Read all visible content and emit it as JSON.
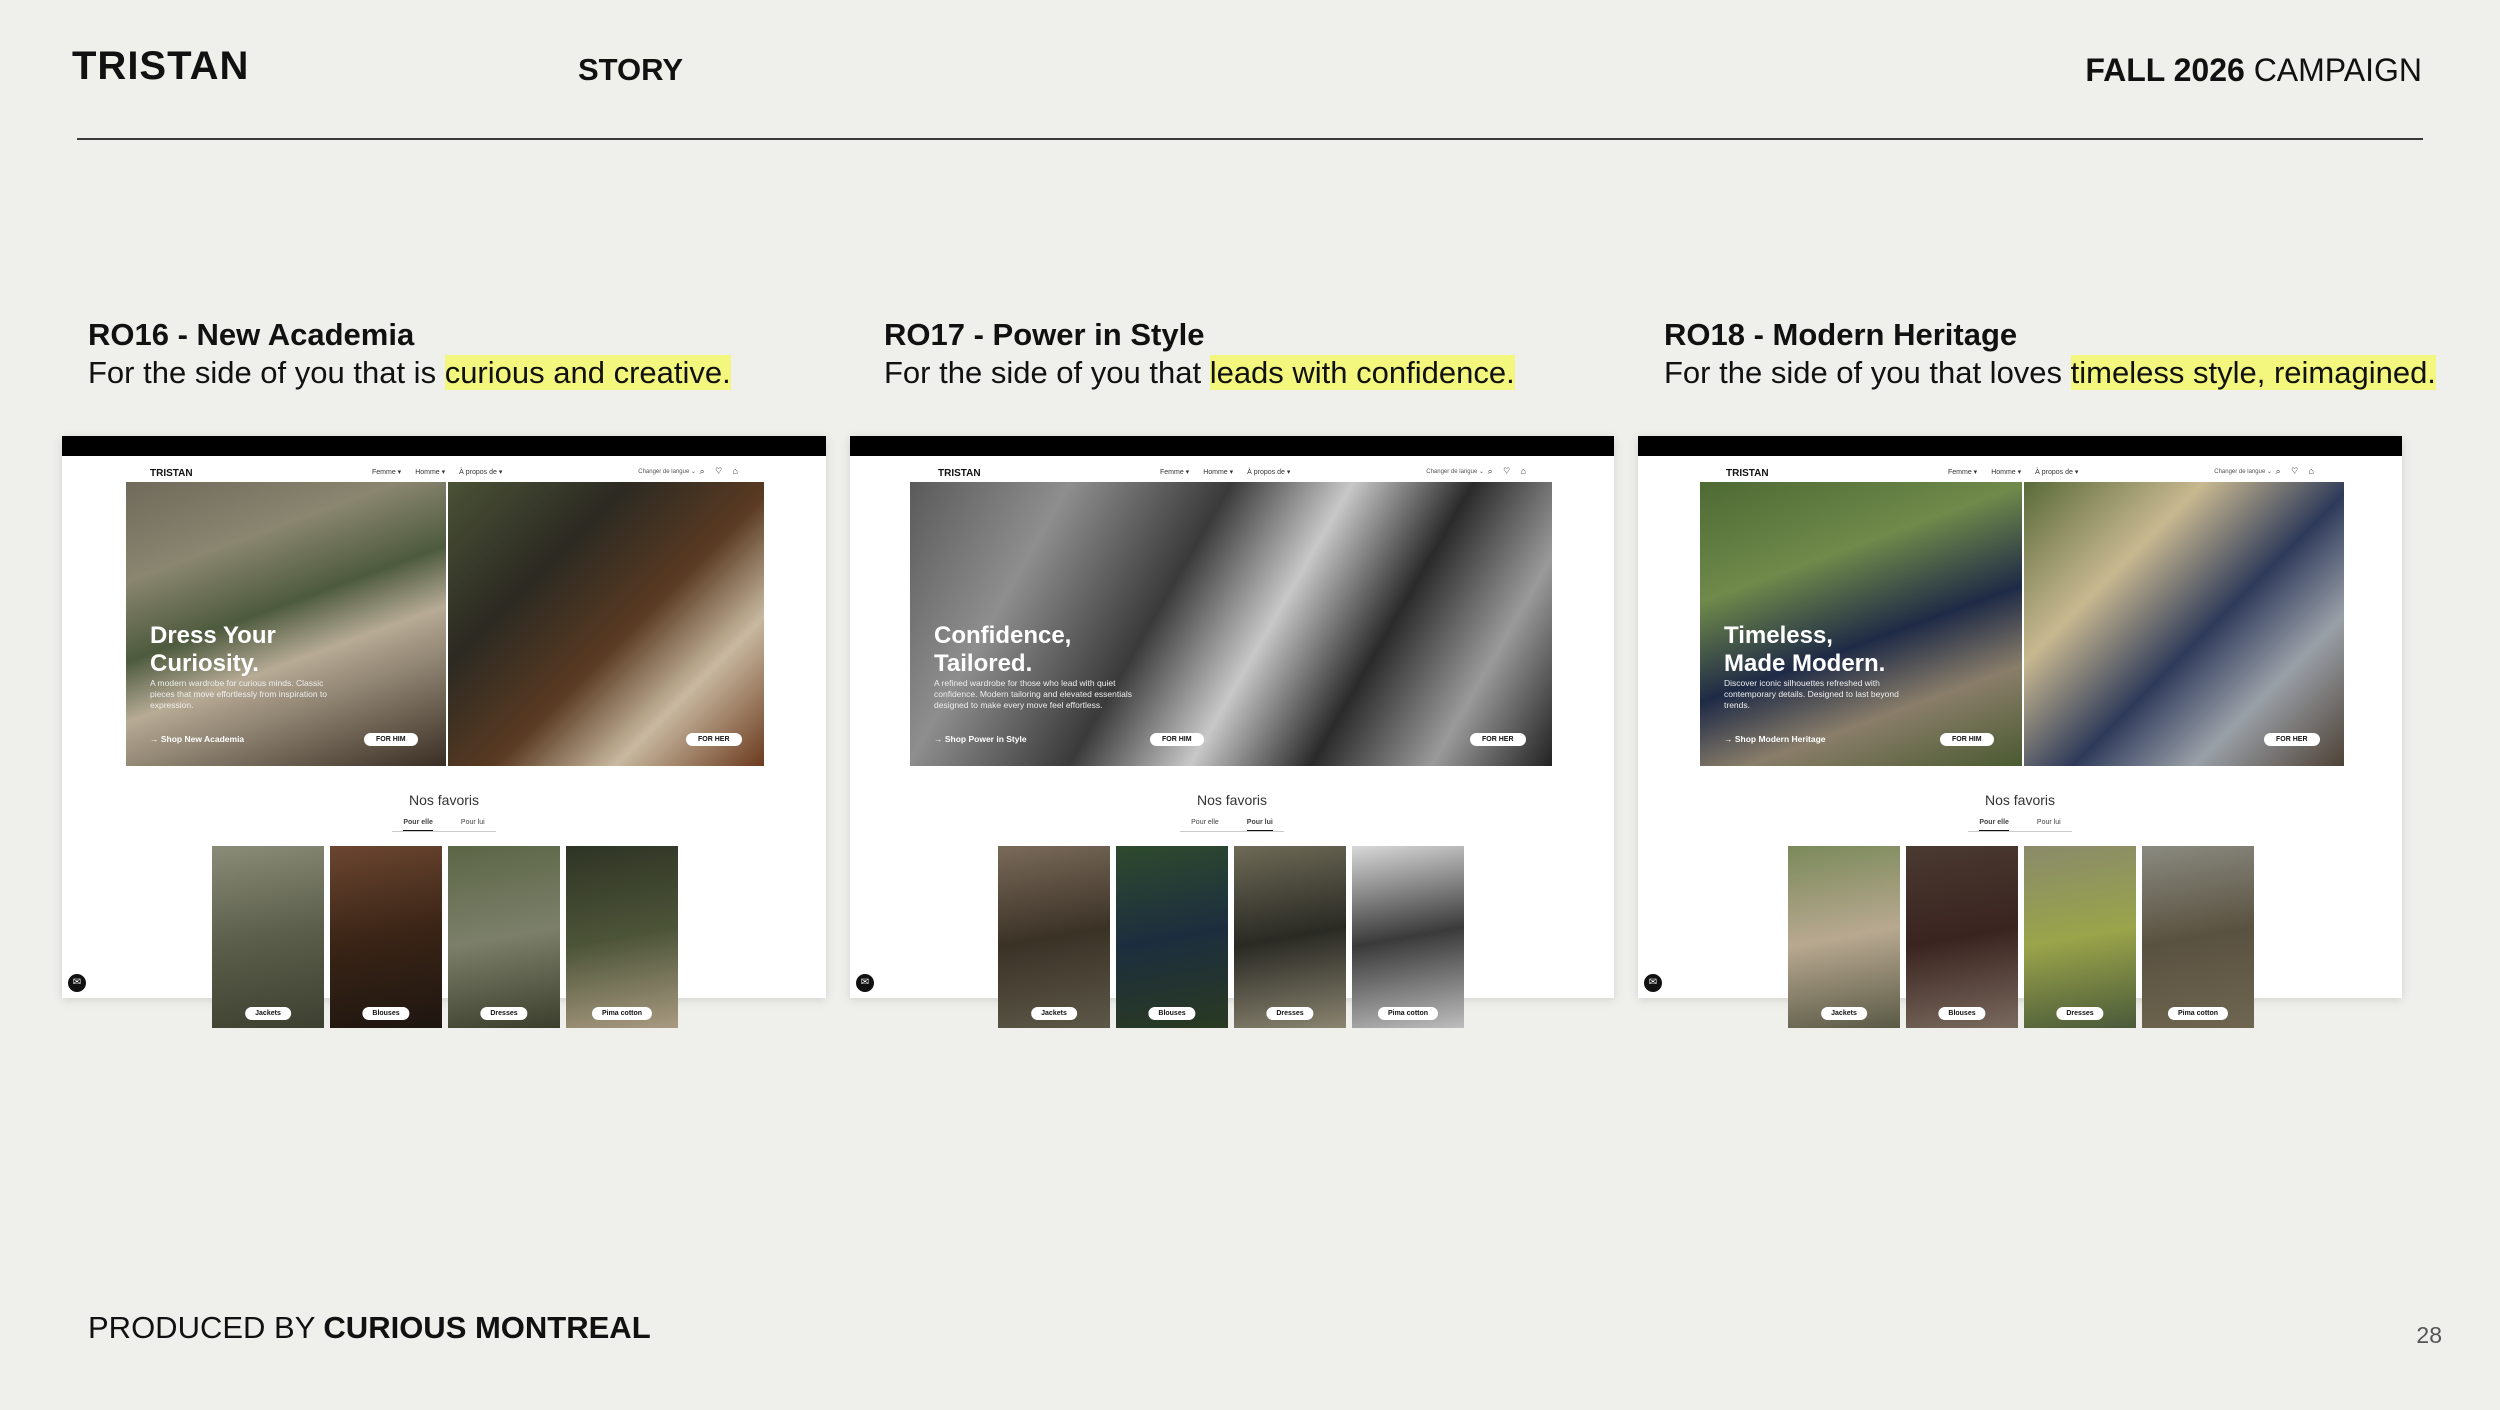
{
  "header": {
    "brand": "TRISTAN",
    "section": "STORY",
    "campaign_bold": "FALL 2026",
    "campaign_rest": " CAMPAIGN"
  },
  "footer": {
    "produced_prefix": "PRODUCED BY ",
    "produced_by": "CURIOUS MONTREAL",
    "page_number": "28"
  },
  "columns": [
    {
      "title": "RO16 - New Academia",
      "tagline_prefix": "For the side of you that is ",
      "tagline_highlight": "curious and creative.",
      "site": {
        "logo": "TRISTAN",
        "nav": [
          "Femme ▾",
          "Homme ▾",
          "À propos de ▾"
        ],
        "lang": "Changer de langue ⌄",
        "icons": "⌕ ♡ ⌂",
        "hero_title": "Dress Your\nCuriosity.",
        "hero_desc": "A modern wardrobe for curious minds. Classic pieces that move effortlessly from inspiration to expression.",
        "hero_cta": "→ Shop New Academia",
        "for_him": "FOR HIM",
        "for_her": "FOR HER",
        "favorites": "Nos favoris",
        "tab_her": "Pour elle",
        "tab_him": "Pour lui",
        "active_tab": "her",
        "cards": [
          "Jackets",
          "Blouses",
          "Dresses",
          "Pima cotton"
        ]
      }
    },
    {
      "title": "RO17 - Power in Style",
      "tagline_prefix": "For the side of you that ",
      "tagline_highlight": "leads with confidence.",
      "site": {
        "logo": "TRISTAN",
        "nav": [
          "Femme ▾",
          "Homme ▾",
          "À propos de ▾"
        ],
        "lang": "Changer de langue ⌄",
        "icons": "⌕ ♡ ⌂",
        "hero_title": "Confidence,\nTailored.",
        "hero_desc": "A refined wardrobe for those who lead with quiet confidence. Modern tailoring and elevated essentials designed to make every move feel effortless.",
        "hero_cta": "→ Shop Power in Style",
        "for_him": "FOR HIM",
        "for_her": "FOR HER",
        "favorites": "Nos favoris",
        "tab_her": "Pour elle",
        "tab_him": "Pour lui",
        "active_tab": "him",
        "cards": [
          "Jackets",
          "Blouses",
          "Dresses",
          "Pima cotton"
        ]
      }
    },
    {
      "title": "RO18 - Modern Heritage",
      "tagline_prefix": "For the side of you that loves ",
      "tagline_highlight": "timeless style, reimagined.",
      "site": {
        "logo": "TRISTAN",
        "nav": [
          "Femme ▾",
          "Homme ▾",
          "À propos de ▾"
        ],
        "lang": "Changer de langue ⌄",
        "icons": "⌕ ♡ ⌂",
        "hero_title": "Timeless,\nMade Modern.",
        "hero_desc": "Discover iconic silhouettes refreshed with contemporary details. Designed to last beyond trends.",
        "hero_cta": "→ Shop Modern Heritage",
        "for_him": "FOR HIM",
        "for_her": "FOR HER",
        "favorites": "Nos favoris",
        "tab_her": "Pour elle",
        "tab_him": "Pour lui",
        "active_tab": "her",
        "cards": [
          "Jackets",
          "Blouses",
          "Dresses",
          "Pima cotton"
        ]
      }
    }
  ]
}
